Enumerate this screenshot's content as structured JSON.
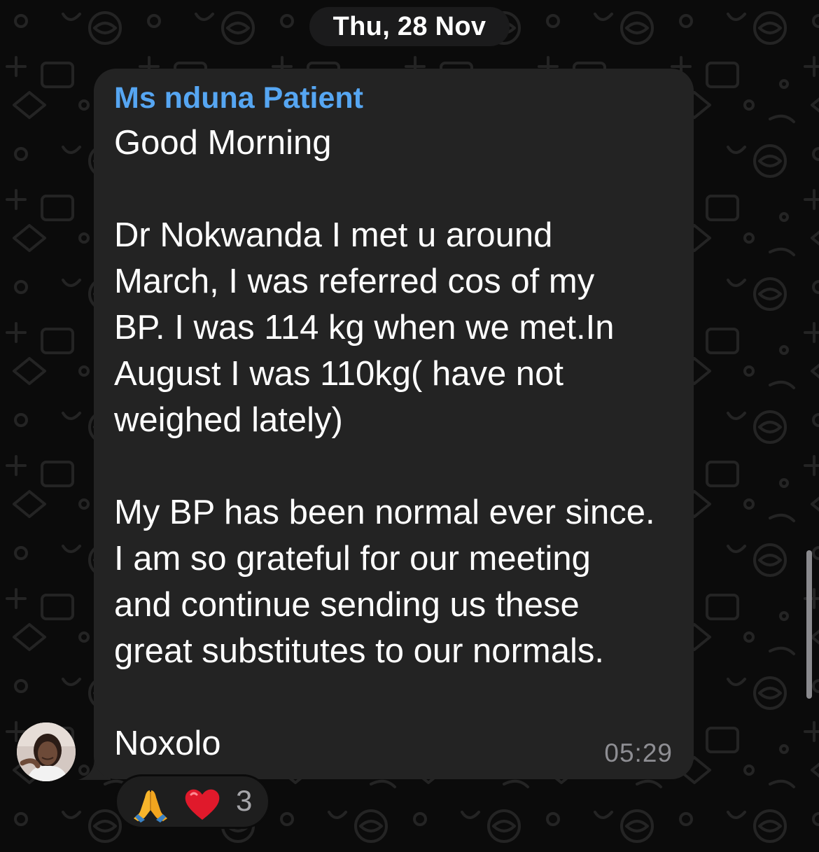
{
  "chat": {
    "date_separator": "Thu, 28 Nov",
    "message": {
      "sender_name": "Ms nduna Patient",
      "text": "Good Morning\n\nDr Nokwanda I met u around\nMarch, I was referred cos of my\nBP. I was 114 kg when we met.In\nAugust I was 110kg( have not\nweighed lately)\n\nMy BP has been normal ever since.\nI am so grateful for our meeting\nand continue sending us these\ngreat substitutes to our normals.\n\nNoxolo",
      "time": "05:29",
      "reactions": {
        "emojis": [
          "folded-hands",
          "red-heart"
        ],
        "count": "3"
      }
    }
  },
  "colors": {
    "background": "#0b0b0b",
    "bubble": "#232323",
    "sender_name": "#56a6f2",
    "timestamp": "#8e8e93",
    "reaction_pill": "#1e1e1e"
  }
}
